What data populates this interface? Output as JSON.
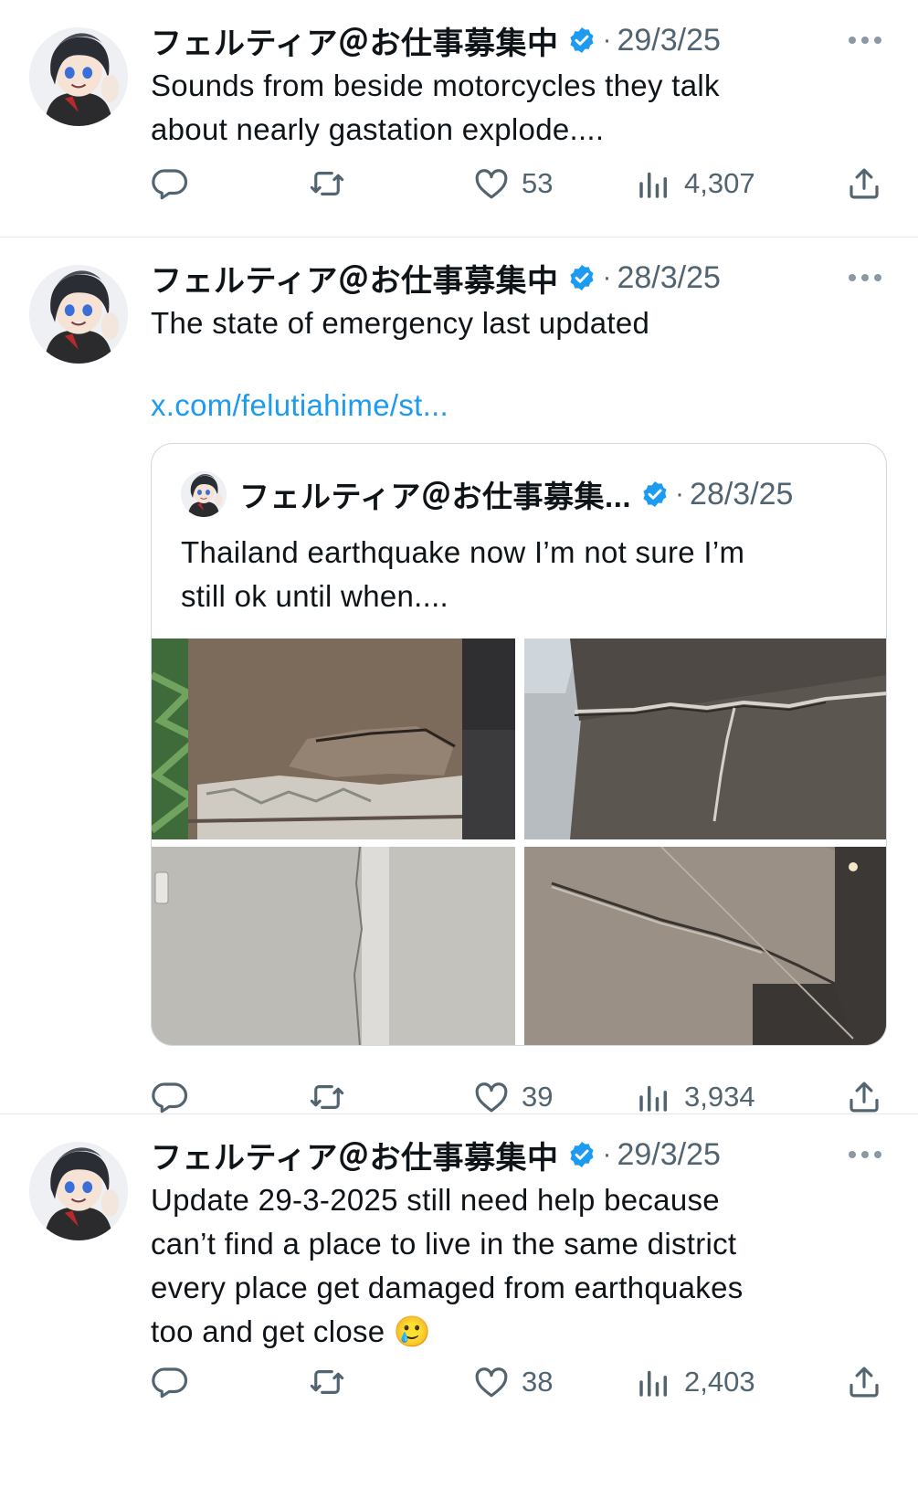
{
  "tweets": [
    {
      "author": "フェルティア＠お仕事募集中",
      "separator": "·",
      "date": "29/3/25",
      "text_lines": [
        "Sounds from beside motorcycles they talk",
        "about nearly gastation explode...."
      ],
      "actions": {
        "likes": "53",
        "views": "4,307"
      }
    },
    {
      "author": "フェルティア＠お仕事募集中",
      "separator": "·",
      "date": "28/3/25",
      "text_lines": [
        "The state of emergency last updated"
      ],
      "link": "x.com/felutiahime/st...",
      "quote": {
        "author": "フェルティア＠お仕事募集...",
        "separator": "·",
        "date": "28/3/25",
        "text_lines": [
          "Thailand earthquake now I’m not sure I’m",
          "still ok until when...."
        ]
      },
      "actions": {
        "likes": "39",
        "views": "3,934"
      }
    },
    {
      "author": "フェルティア＠お仕事募集中",
      "separator": "·",
      "date": "29/3/25",
      "text_lines": [
        "Update 29-3-2025 still need help because",
        "can’t find a place to live in the same district",
        "every place get damaged from earthquakes",
        "too and get close 🥲"
      ],
      "actions": {
        "likes": "38",
        "views": "2,403"
      }
    }
  ],
  "colors": {
    "verified": "#1d9bf0",
    "muted": "#536471",
    "link": "#1d9bf0"
  }
}
